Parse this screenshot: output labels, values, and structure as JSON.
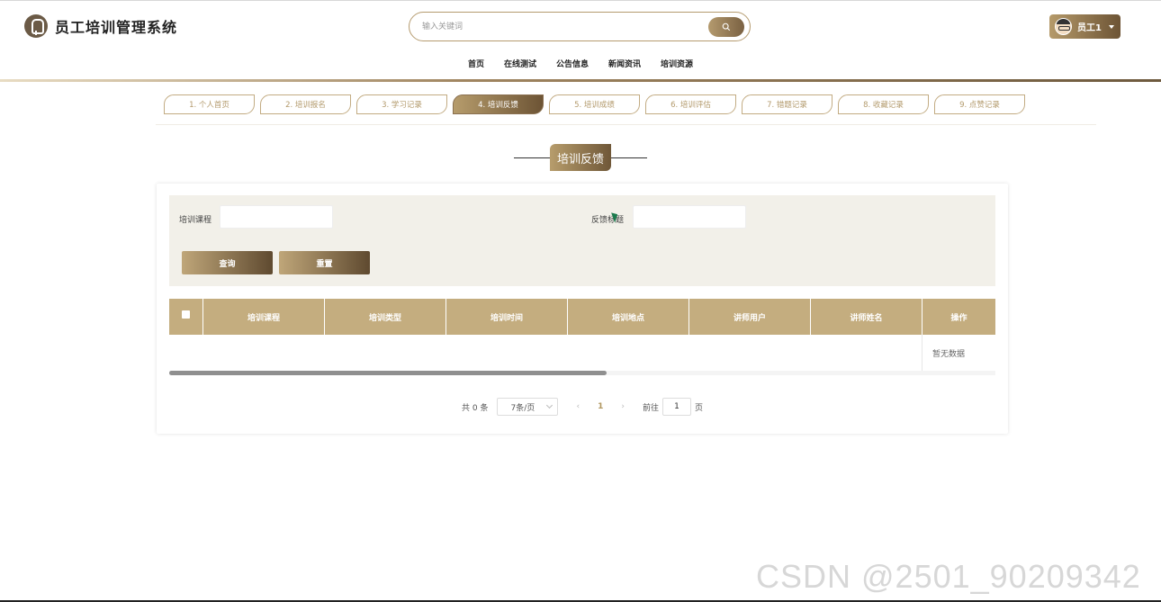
{
  "header": {
    "app_title": "员工培训管理系统",
    "search_placeholder": "输入关键词",
    "user_name": "员工1"
  },
  "topnav": [
    "首页",
    "在线测试",
    "公告信息",
    "新闻资讯",
    "培训资源"
  ],
  "tabs": [
    {
      "label": "1. 个人首页",
      "active": false
    },
    {
      "label": "2. 培训报名",
      "active": false
    },
    {
      "label": "3. 学习记录",
      "active": false
    },
    {
      "label": "4. 培训反馈",
      "active": true
    },
    {
      "label": "5. 培训成绩",
      "active": false
    },
    {
      "label": "6. 培训评估",
      "active": false
    },
    {
      "label": "7. 错题记录",
      "active": false
    },
    {
      "label": "8. 收藏记录",
      "active": false
    },
    {
      "label": "9. 点赞记录",
      "active": false
    }
  ],
  "section_title": "培训反馈",
  "filter": {
    "course_label": "培训课程",
    "course_value": "",
    "feedback_label": "反馈标题",
    "feedback_value": "",
    "query_button": "查询",
    "reset_button": "重置"
  },
  "table": {
    "columns": [
      "培训课程",
      "培训类型",
      "培训时间",
      "培训地点",
      "讲师用户",
      "讲师姓名",
      "操作"
    ],
    "rows": [],
    "empty_text": "暂无数据"
  },
  "pagination": {
    "total_text": "共 0 条",
    "page_size": "7条/页",
    "current_page": "1",
    "goto_label": "前往",
    "goto_value": "1",
    "page_suffix": "页"
  },
  "watermark": "CSDN @2501_90209342",
  "colors": {
    "accent_light": "#c4ad7f",
    "accent_dark": "#6d5435"
  }
}
